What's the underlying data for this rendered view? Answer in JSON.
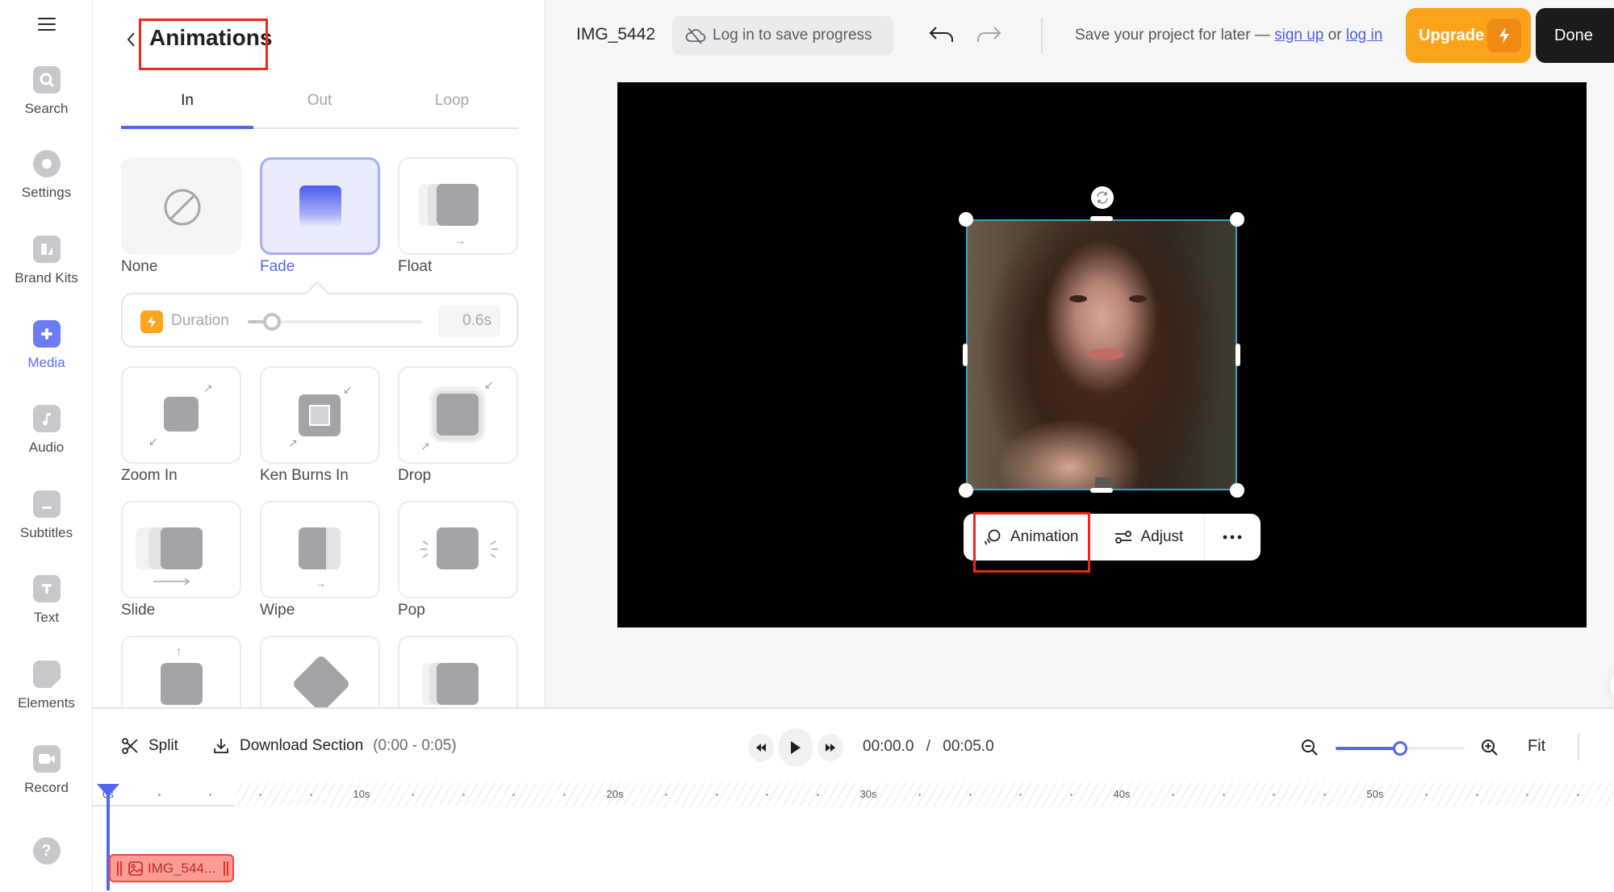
{
  "sidebar": {
    "items": [
      {
        "label": "Search",
        "icon": "search-icon"
      },
      {
        "label": "Settings",
        "icon": "gear-icon"
      },
      {
        "label": "Brand Kits",
        "icon": "brand-kit-icon"
      },
      {
        "label": "Media",
        "icon": "plus-icon",
        "active": true
      },
      {
        "label": "Audio",
        "icon": "music-note-icon"
      },
      {
        "label": "Subtitles",
        "icon": "subtitles-icon"
      },
      {
        "label": "Text",
        "icon": "text-icon"
      },
      {
        "label": "Elements",
        "icon": "sticker-icon"
      },
      {
        "label": "Record",
        "icon": "video-camera-icon"
      }
    ],
    "help_icon": "question-icon"
  },
  "panel": {
    "title": "Animations",
    "tabs": [
      {
        "label": "In",
        "active": true
      },
      {
        "label": "Out"
      },
      {
        "label": "Loop"
      }
    ],
    "animations": [
      {
        "label": "None"
      },
      {
        "label": "Fade",
        "selected": true
      },
      {
        "label": "Float"
      },
      {
        "label": "Zoom In"
      },
      {
        "label": "Ken Burns In"
      },
      {
        "label": "Drop"
      },
      {
        "label": "Slide"
      },
      {
        "label": "Wipe"
      },
      {
        "label": "Pop"
      },
      {
        "label": ""
      },
      {
        "label": ""
      },
      {
        "label": ""
      }
    ],
    "duration": {
      "label": "Duration",
      "value_text": "0.6s",
      "slider_fraction": 0.14
    }
  },
  "topbar": {
    "project_name": "IMG_5442",
    "save_pill": "Log in to save progress",
    "save_prompt": "Save your project for later —",
    "sign_up": "sign up",
    "or": "or",
    "log_in": "log in",
    "upgrade": "Upgrade",
    "done": "Done"
  },
  "canvas": {
    "selection_color": "#35a6c2",
    "toolbar": {
      "animation": "Animation",
      "adjust": "Adjust",
      "more": "more-options"
    }
  },
  "timeline": {
    "split": "Split",
    "download_section": "Download Section",
    "download_range": "(0:00 - 0:05)",
    "current_time": "00:00.0",
    "separator": "/",
    "total_time": "00:05.0",
    "zoom_fraction": 0.5,
    "fit": "Fit",
    "ruler_labels": [
      "0s",
      "10s",
      "20s",
      "30s",
      "40s",
      "50s"
    ],
    "clip_label": "IMG_544..."
  },
  "colors": {
    "accent": "#5266ee",
    "upgrade": "#fca31c",
    "highlight_red": "#f2271c",
    "clip_fill": "#fb9c96"
  }
}
